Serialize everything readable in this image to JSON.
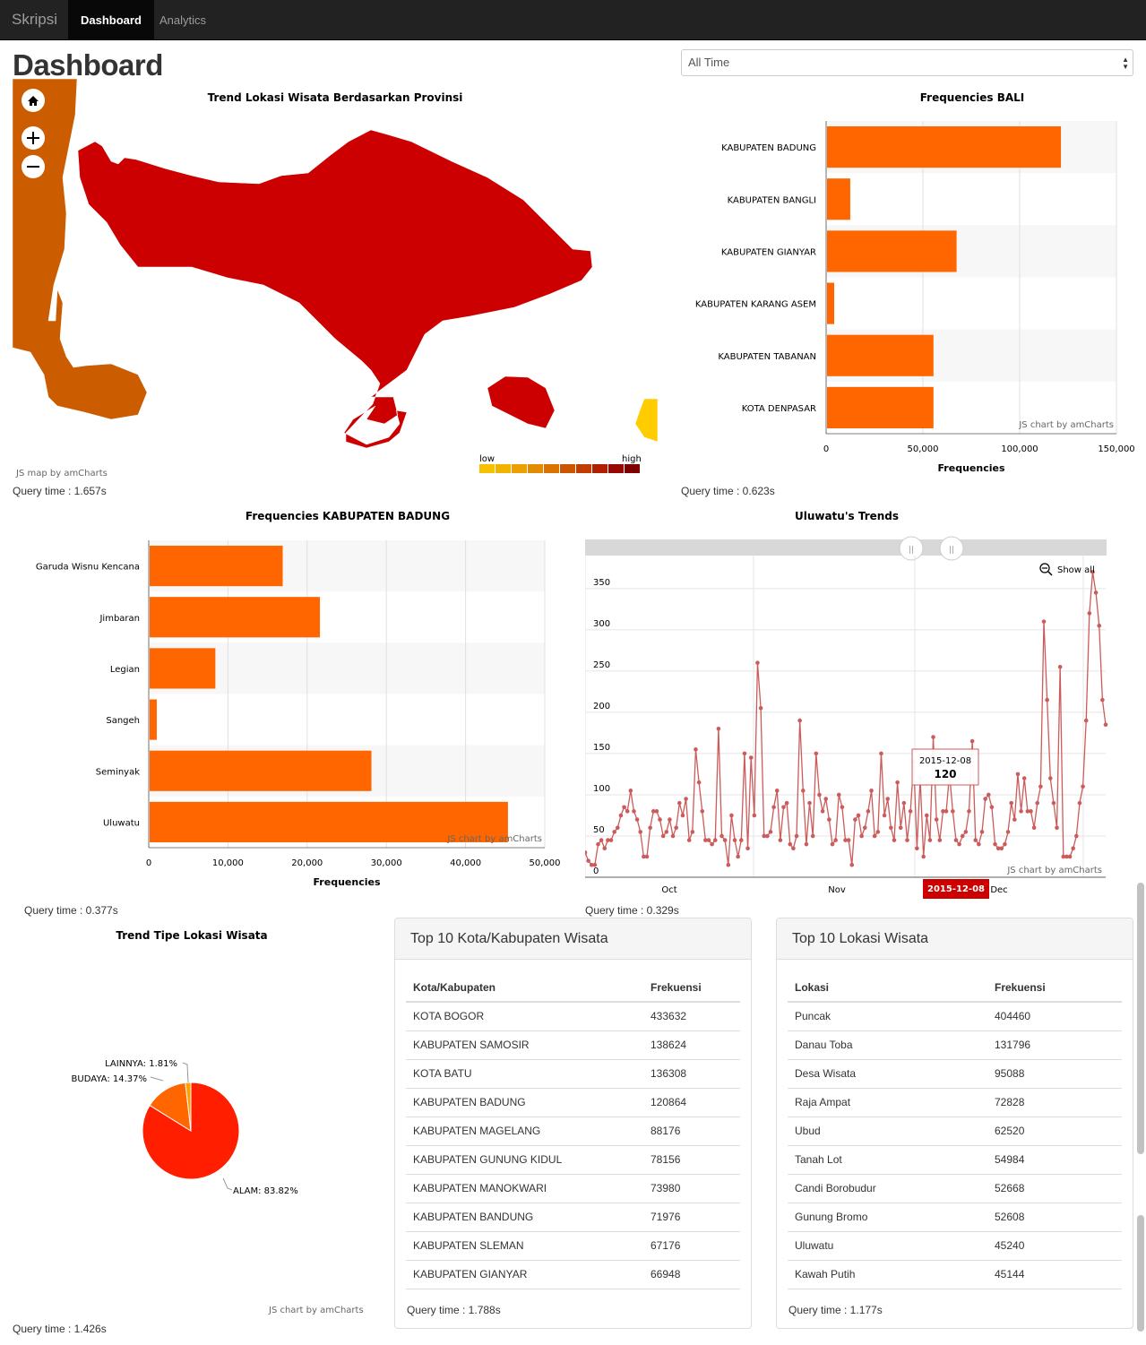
{
  "navbar": {
    "brand": "Skripsi",
    "items": [
      {
        "label": "Dashboard",
        "active": true
      },
      {
        "label": "Analytics",
        "active": false
      }
    ]
  },
  "page_title": "Dashboard",
  "time_filter": {
    "selected": "All Time"
  },
  "map": {
    "title": "Trend Lokasi Wisata Berdasarkan Provinsi",
    "credit": "JS map by amCharts",
    "legend_low": "low",
    "legend_high": "high",
    "query_time": "Query time : 1.657s",
    "colors": {
      "bali": "#cc0000",
      "east_java": "#cc5c00",
      "ntb": "#ffcc00"
    },
    "legend_colors": [
      "#f7c100",
      "#f2b300",
      "#eba000",
      "#e38b00",
      "#d97200",
      "#cc5500",
      "#c23c00",
      "#b02000",
      "#990800",
      "#800000"
    ]
  },
  "charts": [
    {
      "type": "bar",
      "orientation": "horizontal",
      "title": "Frequencies BALI",
      "categories": [
        "KABUPATEN BADUNG",
        "KABUPATEN BANGLI",
        "KABUPATEN GIANYAR",
        "KABUPATEN KARANG ASEM",
        "KABUPATEN TABANAN",
        "KOTA DENPASAR"
      ],
      "values": [
        120864,
        12000,
        66948,
        3700,
        55000,
        55000
      ],
      "xlabel": "Frequencies",
      "xlim": [
        0,
        150000
      ],
      "ticks": [
        "0",
        "50,000",
        "100,000",
        "150,000"
      ],
      "color": "#ff6600",
      "credit": "JS chart by amCharts",
      "query_time": "Query time : 0.623s"
    },
    {
      "type": "bar",
      "orientation": "horizontal",
      "title": "Frequencies KABUPATEN BADUNG",
      "categories": [
        "Garuda Wisnu Kencana",
        "Jimbaran",
        "Legian",
        "Sangeh",
        "Seminyak",
        "Uluwatu"
      ],
      "values": [
        16800,
        21500,
        8300,
        900,
        28000,
        45240
      ],
      "xlabel": "Frequencies",
      "xlim": [
        0,
        50000
      ],
      "ticks": [
        "0",
        "10,000",
        "20,000",
        "30,000",
        "40,000",
        "50,000"
      ],
      "color": "#ff6600",
      "credit": "JS chart by amCharts",
      "query_time": "Query time : 0.377s"
    },
    {
      "type": "line",
      "title": "Uluwatu's Trends",
      "ylim": [
        0,
        390
      ],
      "yticks": [
        "0",
        "50",
        "100",
        "150",
        "200",
        "250",
        "300",
        "350"
      ],
      "months": [
        "Oct",
        "Nov",
        "Dec"
      ],
      "values": [
        30,
        20,
        15,
        15,
        40,
        45,
        35,
        45,
        45,
        55,
        60,
        75,
        85,
        80,
        105,
        80,
        70,
        55,
        25,
        25,
        60,
        80,
        80,
        70,
        50,
        55,
        70,
        50,
        60,
        90,
        75,
        95,
        45,
        55,
        155,
        115,
        80,
        45,
        45,
        40,
        45,
        180,
        50,
        45,
        15,
        75,
        45,
        25,
        45,
        150,
        35,
        145,
        75,
        260,
        205,
        50,
        50,
        55,
        85,
        105,
        45,
        85,
        90,
        40,
        35,
        50,
        190,
        105,
        40,
        90,
        50,
        150,
        100,
        80,
        95,
        70,
        40,
        45,
        100,
        85,
        45,
        45,
        15,
        70,
        75,
        50,
        60,
        80,
        105,
        50,
        55,
        150,
        75,
        95,
        60,
        45,
        115,
        60,
        90,
        45,
        80,
        140,
        35,
        120,
        25,
        75,
        45,
        170,
        70,
        45,
        80,
        80,
        125,
        80,
        45,
        40,
        50,
        55,
        80,
        165,
        45,
        40,
        55,
        95,
        100,
        85,
        40,
        35,
        35,
        40,
        55,
        90,
        70,
        125,
        80,
        120,
        80,
        80,
        60,
        90,
        110,
        310,
        215,
        120,
        90,
        60,
        255,
        25,
        25,
        25,
        35,
        50,
        90,
        110,
        190,
        320,
        370,
        345,
        305,
        215,
        185
      ],
      "cursor_label": "2015-12-08",
      "tooltip": {
        "date": "2015-12-08",
        "value": "120"
      },
      "scroll_show_all": "Show all",
      "color": "#cc5b5b",
      "credit": "JS chart by amCharts",
      "query_time": "Query time : 0.329s"
    },
    {
      "type": "pie",
      "title": "Trend Tipe Lokasi Wisata",
      "slices": [
        {
          "label": "ALAM: 83.82%",
          "value": 83.82,
          "color": "#ff1f00"
        },
        {
          "label": "BUDAYA: 14.37%",
          "value": 14.37,
          "color": "#ff6600"
        },
        {
          "label": "LAINNYA: 1.81%",
          "value": 1.81,
          "color": "#ff9e01"
        }
      ],
      "credit": "JS chart by amCharts",
      "query_time": "Query time : 1.426s"
    }
  ],
  "top_kota": {
    "title": "Top 10 Kota/Kabupaten Wisata",
    "headers": [
      "Kota/Kabupaten",
      "Frekuensi"
    ],
    "rows": [
      [
        "KOTA BOGOR",
        "433632"
      ],
      [
        "KABUPATEN SAMOSIR",
        "138624"
      ],
      [
        "KOTA BATU",
        "136308"
      ],
      [
        "KABUPATEN BADUNG",
        "120864"
      ],
      [
        "KABUPATEN MAGELANG",
        "88176"
      ],
      [
        "KABUPATEN GUNUNG KIDUL",
        "78156"
      ],
      [
        "KABUPATEN MANOKWARI",
        "73980"
      ],
      [
        "KABUPATEN BANDUNG",
        "71976"
      ],
      [
        "KABUPATEN SLEMAN",
        "67176"
      ],
      [
        "KABUPATEN GIANYAR",
        "66948"
      ]
    ],
    "query_time": "Query time : 1.788s"
  },
  "top_lokasi": {
    "title": "Top 10 Lokasi Wisata",
    "headers": [
      "Lokasi",
      "Frekuensi"
    ],
    "rows": [
      [
        "Puncak",
        "404460"
      ],
      [
        "Danau Toba",
        "131796"
      ],
      [
        "Desa Wisata",
        "95088"
      ],
      [
        "Raja Ampat",
        "72828"
      ],
      [
        "Ubud",
        "62520"
      ],
      [
        "Tanah Lot",
        "54984"
      ],
      [
        "Candi Borobudur",
        "52668"
      ],
      [
        "Gunung Bromo",
        "52608"
      ],
      [
        "Uluwatu",
        "45240"
      ],
      [
        "Kawah Putih",
        "45144"
      ]
    ],
    "query_time": "Query time : 1.177s"
  }
}
